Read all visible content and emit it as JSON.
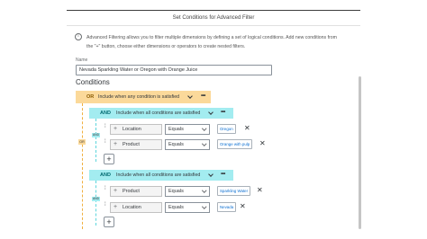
{
  "dialog": {
    "title": "Set Conditions for Advanced Filter",
    "info_line1": "Advanced Filtering allows you to filter multiple dimensions by defining a set of logical conditions. Add new conditions from",
    "info_line2": "the \"+\" button, choose either dimensions or operators to create nested filters."
  },
  "name_field": {
    "label": "Name",
    "value": "Nevada Sparkling Water or Oregon with Orange Juice"
  },
  "conditions": {
    "title": "Conditions",
    "root": {
      "operator": "OR",
      "description": "Include when any condition is satisfied",
      "tag": "OR"
    },
    "groups": [
      {
        "operator": "AND",
        "description": "Include when all conditions are satisfied",
        "tag": "AND",
        "rows": [
          {
            "dimension": "Location",
            "operator": "Equals",
            "value": "Oregon"
          },
          {
            "dimension": "Product",
            "operator": "Equals",
            "value": "Orange with pulp"
          }
        ]
      },
      {
        "operator": "AND",
        "description": "Include when all conditions are satisfied",
        "tag": "AND",
        "rows": [
          {
            "dimension": "Product",
            "operator": "Equals",
            "value": "Sparkling Water"
          },
          {
            "dimension": "Location",
            "operator": "Equals",
            "value": "Nevada"
          }
        ]
      }
    ],
    "add_symbol": "+",
    "more_symbol": "•••",
    "remove_symbol": "✕"
  },
  "colors": {
    "or_accent": "#fbd99a",
    "and_accent": "#a3ecf0",
    "link_blue": "#0a6ed1"
  }
}
